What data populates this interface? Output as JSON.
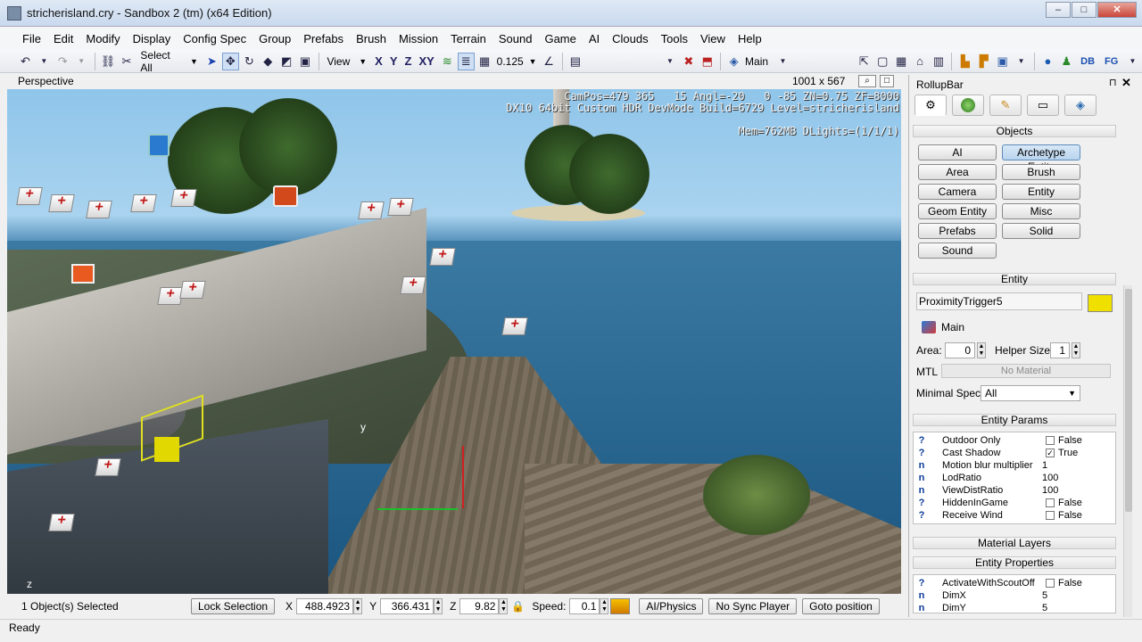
{
  "window": {
    "title": "stricherisland.cry - Sandbox 2 (tm) (x64 Edition)",
    "min": "–",
    "max": "□",
    "close": "✕"
  },
  "menu": [
    "File",
    "Edit",
    "Modify",
    "Display",
    "Config Spec",
    "Group",
    "Prefabs",
    "Brush",
    "Mission",
    "Terrain",
    "Sound",
    "Game",
    "AI",
    "Clouds",
    "Tools",
    "View",
    "Help"
  ],
  "toolbar": {
    "undo": "↶",
    "redo": "↷",
    "select_filter": "Select All",
    "ref_coord": "View",
    "axis": [
      "X",
      "Y",
      "Z",
      "XY"
    ],
    "snap_value": "0.125",
    "layer": "Main",
    "right_labels": [
      "DB",
      "FG"
    ]
  },
  "viewport": {
    "label": "Perspective",
    "size_label": "1001 x 567",
    "hud_lines": [
      "CamPos=479 365   15 Angl=-20   0 -85 ZN=0.75 ZF=8000",
      "DX10 64bit Custom HDR DevMode Build=6729 Level=stricherisland",
      "Mem=762MB DLights=(1/1/1)"
    ],
    "gizmo_y": "y",
    "gizmo_z": "z"
  },
  "status": {
    "selection": "1 Object(s) Selected",
    "lock_selection": "Lock Selection",
    "x_label": "X",
    "x_value": "488.4923",
    "y_label": "Y",
    "y_value": "366.431",
    "z_label": "Z",
    "z_value": "9.82",
    "speed_label": "Speed:",
    "speed_value": "0.1",
    "ai_physics": "AI/Physics",
    "no_sync_player": "No Sync Player",
    "goto_position": "Goto position",
    "ready": "Ready"
  },
  "rollup": {
    "title": "RollupBar",
    "pin": "⊓",
    "close": "✕",
    "objects_header": "Objects",
    "object_buttons": [
      {
        "label": "AI",
        "pressed": false
      },
      {
        "label": "Archetype Entity",
        "pressed": true
      },
      {
        "label": "Area",
        "pressed": false
      },
      {
        "label": "Brush",
        "pressed": false
      },
      {
        "label": "Camera",
        "pressed": false
      },
      {
        "label": "Entity",
        "pressed": false
      },
      {
        "label": "Geom Entity",
        "pressed": false
      },
      {
        "label": "Misc",
        "pressed": false
      },
      {
        "label": "Prefabs",
        "pressed": false
      },
      {
        "label": "Solid",
        "pressed": false
      },
      {
        "label": "Sound",
        "pressed": false
      }
    ],
    "entity_header": "Entity",
    "entity_name": "ProximityTrigger5",
    "entity_color": "#f0e000",
    "layer_name": "Main",
    "area_label": "Area:",
    "area_value": "0",
    "helper_label": "Helper Size:",
    "helper_value": "1",
    "mtl_label": "MTL",
    "mtl_value": "No Material",
    "minspec_label": "Minimal Spec:",
    "minspec_value": "All",
    "params_header": "Entity Params",
    "params": [
      {
        "kind": "?",
        "name": "Outdoor Only",
        "checkbox": true,
        "checked": false,
        "value": "False"
      },
      {
        "kind": "?",
        "name": "Cast Shadow",
        "checkbox": true,
        "checked": true,
        "value": "True"
      },
      {
        "kind": "n",
        "name": "Motion blur multiplier",
        "checkbox": false,
        "value": "1"
      },
      {
        "kind": "n",
        "name": "LodRatio",
        "checkbox": false,
        "value": "100"
      },
      {
        "kind": "n",
        "name": "ViewDistRatio",
        "checkbox": false,
        "value": "100"
      },
      {
        "kind": "?",
        "name": "HiddenInGame",
        "checkbox": true,
        "checked": false,
        "value": "False"
      },
      {
        "kind": "?",
        "name": "Receive Wind",
        "checkbox": true,
        "checked": false,
        "value": "False"
      }
    ],
    "material_layers_header": "Material Layers",
    "entity_properties_header": "Entity Properties",
    "props": [
      {
        "kind": "?",
        "name": "ActivateWithScoutOff",
        "value": "False"
      },
      {
        "kind": "n",
        "name": "DimX",
        "value": "5"
      },
      {
        "kind": "n",
        "name": "DimY",
        "value": "5"
      }
    ]
  }
}
